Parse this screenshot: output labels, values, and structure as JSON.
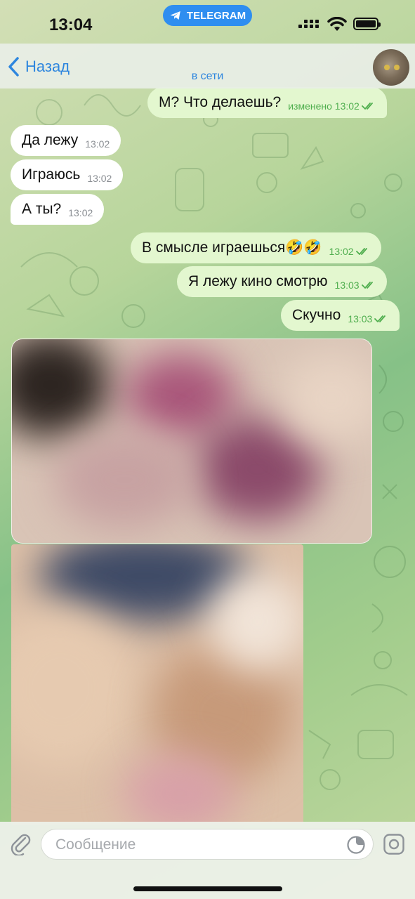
{
  "status_bar": {
    "time": "13:04",
    "app_pill": "TELEGRAM"
  },
  "header": {
    "back_label": "Назад",
    "status": "в сети"
  },
  "messages": [
    {
      "direction": "out",
      "text": "М? Что делаешь?",
      "time": "изменено 13:02",
      "read": true
    },
    {
      "direction": "in",
      "text": "Да лежу",
      "time": "13:02"
    },
    {
      "direction": "in",
      "text": "Играюсь",
      "time": "13:02"
    },
    {
      "direction": "in",
      "text": "А ты?",
      "time": "13:02"
    },
    {
      "direction": "out",
      "text": "В смысле играешься🤣🤣",
      "time": "13:02",
      "read": true
    },
    {
      "direction": "out",
      "text": "Я лежу кино смотрю",
      "time": "13:03",
      "read": true
    },
    {
      "direction": "out",
      "text": "Скучно",
      "time": "13:03",
      "read": true
    }
  ],
  "media": [
    {
      "type": "photo",
      "blurred": true
    },
    {
      "type": "photo",
      "blurred": true
    }
  ],
  "composer": {
    "placeholder": "Сообщение"
  },
  "icons": [
    "telegram-icon",
    "signal-icon",
    "wifi-icon",
    "battery-icon",
    "back-chevron-icon",
    "attach-icon",
    "sticker-icon",
    "camera-icon",
    "read-checkmarks-icon"
  ],
  "colors": {
    "accent": "#2e86de",
    "outgoing_bubble": "#e3f7cf",
    "incoming_bubble": "#ffffff",
    "read_check": "#4fae4e"
  }
}
